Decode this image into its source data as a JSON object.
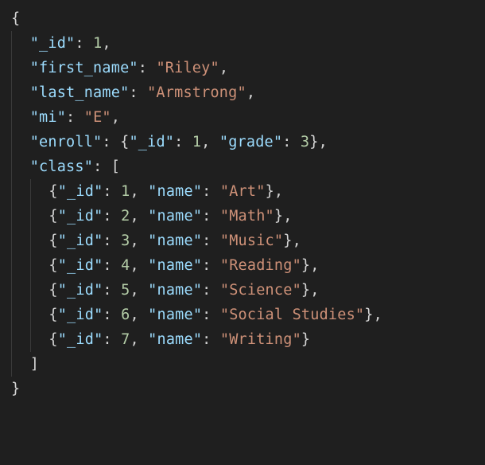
{
  "tokens": [
    [
      {
        "t": "brace",
        "v": "{"
      }
    ],
    [
      {
        "t": "guide"
      },
      {
        "t": "sp",
        "v": "  "
      },
      {
        "t": "key",
        "v": "\"_id\""
      },
      {
        "t": "punc",
        "v": ": "
      },
      {
        "t": "number",
        "v": "1"
      },
      {
        "t": "punc",
        "v": ","
      }
    ],
    [
      {
        "t": "guide"
      },
      {
        "t": "sp",
        "v": "  "
      },
      {
        "t": "key",
        "v": "\"first_name\""
      },
      {
        "t": "punc",
        "v": ": "
      },
      {
        "t": "string",
        "v": "\"Riley\""
      },
      {
        "t": "punc",
        "v": ","
      }
    ],
    [
      {
        "t": "guide"
      },
      {
        "t": "sp",
        "v": "  "
      },
      {
        "t": "key",
        "v": "\"last_name\""
      },
      {
        "t": "punc",
        "v": ": "
      },
      {
        "t": "string",
        "v": "\"Armstrong\""
      },
      {
        "t": "punc",
        "v": ","
      }
    ],
    [
      {
        "t": "guide"
      },
      {
        "t": "sp",
        "v": "  "
      },
      {
        "t": "key",
        "v": "\"mi\""
      },
      {
        "t": "punc",
        "v": ": "
      },
      {
        "t": "string",
        "v": "\"E\""
      },
      {
        "t": "punc",
        "v": ","
      }
    ],
    [
      {
        "t": "guide"
      },
      {
        "t": "sp",
        "v": "  "
      },
      {
        "t": "key",
        "v": "\"enroll\""
      },
      {
        "t": "punc",
        "v": ": "
      },
      {
        "t": "brace",
        "v": "{"
      },
      {
        "t": "key",
        "v": "\"_id\""
      },
      {
        "t": "punc",
        "v": ": "
      },
      {
        "t": "number",
        "v": "1"
      },
      {
        "t": "punc",
        "v": ", "
      },
      {
        "t": "key",
        "v": "\"grade\""
      },
      {
        "t": "punc",
        "v": ": "
      },
      {
        "t": "number",
        "v": "3"
      },
      {
        "t": "brace",
        "v": "}"
      },
      {
        "t": "punc",
        "v": ","
      }
    ],
    [
      {
        "t": "guide"
      },
      {
        "t": "sp",
        "v": "  "
      },
      {
        "t": "key",
        "v": "\"class\""
      },
      {
        "t": "punc",
        "v": ": "
      },
      {
        "t": "bracket",
        "v": "["
      }
    ],
    [
      {
        "t": "guide"
      },
      {
        "t": "sp",
        "v": "  "
      },
      {
        "t": "guide"
      },
      {
        "t": "sp",
        "v": "  "
      },
      {
        "t": "brace",
        "v": "{"
      },
      {
        "t": "key",
        "v": "\"_id\""
      },
      {
        "t": "punc",
        "v": ": "
      },
      {
        "t": "number",
        "v": "1"
      },
      {
        "t": "punc",
        "v": ", "
      },
      {
        "t": "key",
        "v": "\"name\""
      },
      {
        "t": "punc",
        "v": ": "
      },
      {
        "t": "string",
        "v": "\"Art\""
      },
      {
        "t": "brace",
        "v": "}"
      },
      {
        "t": "punc",
        "v": ","
      }
    ],
    [
      {
        "t": "guide"
      },
      {
        "t": "sp",
        "v": "  "
      },
      {
        "t": "guide"
      },
      {
        "t": "sp",
        "v": "  "
      },
      {
        "t": "brace",
        "v": "{"
      },
      {
        "t": "key",
        "v": "\"_id\""
      },
      {
        "t": "punc",
        "v": ": "
      },
      {
        "t": "number",
        "v": "2"
      },
      {
        "t": "punc",
        "v": ", "
      },
      {
        "t": "key",
        "v": "\"name\""
      },
      {
        "t": "punc",
        "v": ": "
      },
      {
        "t": "string",
        "v": "\"Math\""
      },
      {
        "t": "brace",
        "v": "}"
      },
      {
        "t": "punc",
        "v": ","
      }
    ],
    [
      {
        "t": "guide"
      },
      {
        "t": "sp",
        "v": "  "
      },
      {
        "t": "guide"
      },
      {
        "t": "sp",
        "v": "  "
      },
      {
        "t": "brace",
        "v": "{"
      },
      {
        "t": "key",
        "v": "\"_id\""
      },
      {
        "t": "punc",
        "v": ": "
      },
      {
        "t": "number",
        "v": "3"
      },
      {
        "t": "punc",
        "v": ", "
      },
      {
        "t": "key",
        "v": "\"name\""
      },
      {
        "t": "punc",
        "v": ": "
      },
      {
        "t": "string",
        "v": "\"Music\""
      },
      {
        "t": "brace",
        "v": "}"
      },
      {
        "t": "punc",
        "v": ","
      }
    ],
    [
      {
        "t": "guide"
      },
      {
        "t": "sp",
        "v": "  "
      },
      {
        "t": "guide"
      },
      {
        "t": "sp",
        "v": "  "
      },
      {
        "t": "brace",
        "v": "{"
      },
      {
        "t": "key",
        "v": "\"_id\""
      },
      {
        "t": "punc",
        "v": ": "
      },
      {
        "t": "number",
        "v": "4"
      },
      {
        "t": "punc",
        "v": ", "
      },
      {
        "t": "key",
        "v": "\"name\""
      },
      {
        "t": "punc",
        "v": ": "
      },
      {
        "t": "string",
        "v": "\"Reading\""
      },
      {
        "t": "brace",
        "v": "}"
      },
      {
        "t": "punc",
        "v": ","
      }
    ],
    [
      {
        "t": "guide"
      },
      {
        "t": "sp",
        "v": "  "
      },
      {
        "t": "guide"
      },
      {
        "t": "sp",
        "v": "  "
      },
      {
        "t": "brace",
        "v": "{"
      },
      {
        "t": "key",
        "v": "\"_id\""
      },
      {
        "t": "punc",
        "v": ": "
      },
      {
        "t": "number",
        "v": "5"
      },
      {
        "t": "punc",
        "v": ", "
      },
      {
        "t": "key",
        "v": "\"name\""
      },
      {
        "t": "punc",
        "v": ": "
      },
      {
        "t": "string",
        "v": "\"Science\""
      },
      {
        "t": "brace",
        "v": "}"
      },
      {
        "t": "punc",
        "v": ","
      }
    ],
    [
      {
        "t": "guide"
      },
      {
        "t": "sp",
        "v": "  "
      },
      {
        "t": "guide"
      },
      {
        "t": "sp",
        "v": "  "
      },
      {
        "t": "brace",
        "v": "{"
      },
      {
        "t": "key",
        "v": "\"_id\""
      },
      {
        "t": "punc",
        "v": ": "
      },
      {
        "t": "number",
        "v": "6"
      },
      {
        "t": "punc",
        "v": ", "
      },
      {
        "t": "key",
        "v": "\"name\""
      },
      {
        "t": "punc",
        "v": ": "
      },
      {
        "t": "string",
        "v": "\"Social Studies\""
      },
      {
        "t": "brace",
        "v": "}"
      },
      {
        "t": "punc",
        "v": ","
      }
    ],
    [
      {
        "t": "guide"
      },
      {
        "t": "sp",
        "v": "  "
      },
      {
        "t": "guide"
      },
      {
        "t": "sp",
        "v": "  "
      },
      {
        "t": "brace",
        "v": "{"
      },
      {
        "t": "key",
        "v": "\"_id\""
      },
      {
        "t": "punc",
        "v": ": "
      },
      {
        "t": "number",
        "v": "7"
      },
      {
        "t": "punc",
        "v": ", "
      },
      {
        "t": "key",
        "v": "\"name\""
      },
      {
        "t": "punc",
        "v": ": "
      },
      {
        "t": "string",
        "v": "\"Writing\""
      },
      {
        "t": "brace",
        "v": "}"
      }
    ],
    [
      {
        "t": "guide"
      },
      {
        "t": "sp",
        "v": "  "
      },
      {
        "t": "bracket",
        "v": "]"
      }
    ],
    [
      {
        "t": "brace",
        "v": "}"
      }
    ]
  ]
}
